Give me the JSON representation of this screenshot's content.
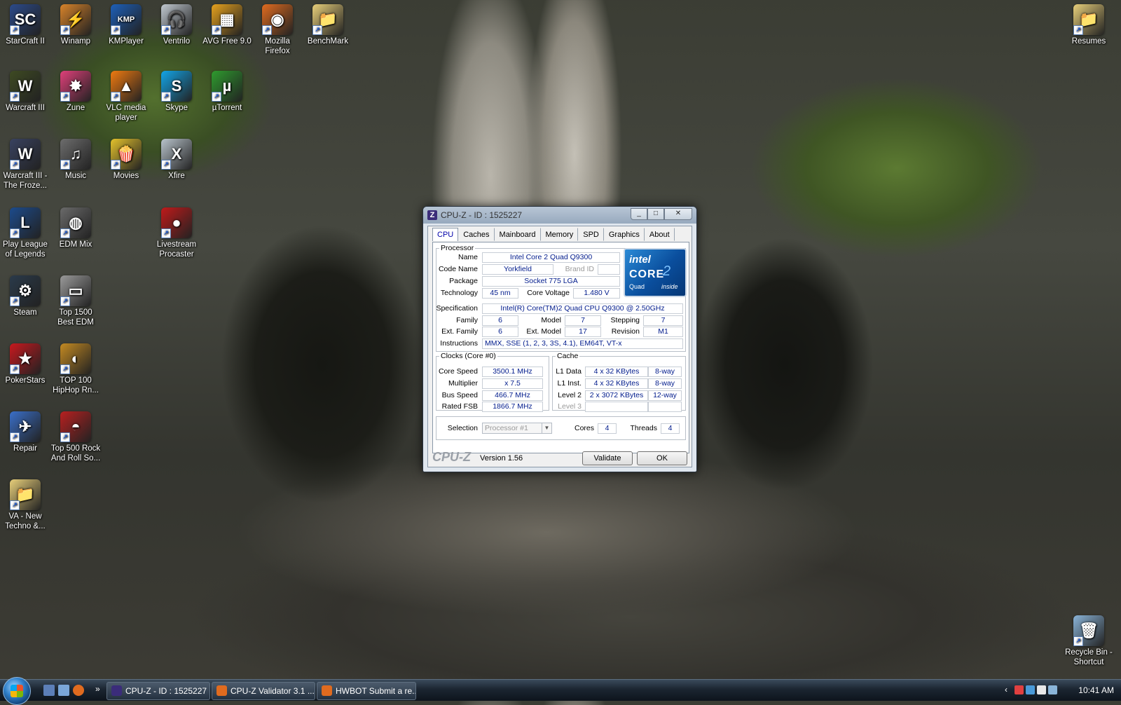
{
  "desktop": {
    "icons": [
      {
        "label": "StarCraft II",
        "symbol": "SC",
        "color": "#2b4a8a"
      },
      {
        "label": "Winamp",
        "symbol": "⚡",
        "color": "#d8832a"
      },
      {
        "label": "KMPlayer",
        "symbol": "KMP",
        "color": "#1d5fb8"
      },
      {
        "label": "Ventrilo",
        "symbol": "🎧",
        "color": "#c0c8d0"
      },
      {
        "label": "AVG Free 9.0",
        "symbol": "▦",
        "color": "#e6a11d"
      },
      {
        "label": "Mozilla Firefox",
        "symbol": "◉",
        "color": "#e06b1f"
      },
      {
        "label": "BenchMark",
        "symbol": "📁",
        "color": "#e8cf7a"
      },
      {
        "label": "Warcraft III",
        "symbol": "W",
        "color": "#3e4a22"
      },
      {
        "label": "Zune",
        "symbol": "✸",
        "color": "#e0407a"
      },
      {
        "label": "VLC media player",
        "symbol": "▲",
        "color": "#f07a10"
      },
      {
        "label": "Skype",
        "symbol": "S",
        "color": "#12a5e8"
      },
      {
        "label": "µTorrent",
        "symbol": "µ",
        "color": "#2e9b2e"
      },
      {
        "label": "Warcraft III - The Froze...",
        "symbol": "W",
        "color": "#394260"
      },
      {
        "label": "Music",
        "symbol": "♫",
        "color": "#6d6d6d"
      },
      {
        "label": "Movies",
        "symbol": "🍿",
        "color": "#e4c22c"
      },
      {
        "label": "Xfire",
        "symbol": "X",
        "color": "#b9c4cc"
      },
      {
        "label": "Play League of Legends",
        "symbol": "L",
        "color": "#1c4b8c"
      },
      {
        "label": "EDM Mix",
        "symbol": "◍",
        "color": "#6a6a6a"
      },
      {
        "label": "Livestream Procaster",
        "symbol": "●",
        "color": "#c01a1a"
      },
      {
        "label": "Steam",
        "symbol": "⚙",
        "color": "#2a3a4a"
      },
      {
        "label": "Top 1500 Best EDM",
        "symbol": "▭",
        "color": "#9a9a9a"
      },
      {
        "label": "PokerStars",
        "symbol": "★",
        "color": "#c8181e"
      },
      {
        "label": "TOP 100 HipHop Rn...",
        "symbol": "◐",
        "color": "#c48a22"
      },
      {
        "label": "Repair",
        "symbol": "✈",
        "color": "#3a6fc9"
      },
      {
        "label": "Top 500 Rock And Roll So...",
        "symbol": "◓",
        "color": "#b82020"
      },
      {
        "label": "VA - New Techno &...",
        "symbol": "📁",
        "color": "#e8cf7a"
      },
      {
        "label": "Resumes",
        "symbol": "📁",
        "color": "#e8cf7a"
      },
      {
        "label": "Recycle Bin - Shortcut",
        "symbol": "🗑",
        "color": "#8ab4d8"
      }
    ]
  },
  "cpuz": {
    "title": "CPU-Z - ID : 1525227",
    "icon_letter": "Z",
    "window_buttons": {
      "minimize": "_",
      "maximize": "□",
      "close": "✕"
    },
    "tabs": [
      "CPU",
      "Caches",
      "Mainboard",
      "Memory",
      "SPD",
      "Graphics",
      "About"
    ],
    "processor": {
      "legend": "Processor",
      "name_label": "Name",
      "name": "Intel Core 2 Quad Q9300",
      "code_name_label": "Code Name",
      "code_name": "Yorkfield",
      "brand_id_label": "Brand ID",
      "brand_id": "",
      "package_label": "Package",
      "package": "Socket 775 LGA",
      "technology_label": "Technology",
      "technology": "45 nm",
      "core_voltage_label": "Core Voltage",
      "core_voltage": "1.480 V",
      "specification_label": "Specification",
      "specification": "Intel(R) Core(TM)2 Quad  CPU   Q9300  @ 2.50GHz",
      "family_label": "Family",
      "family": "6",
      "model_label": "Model",
      "model": "7",
      "stepping_label": "Stepping",
      "stepping": "7",
      "ext_family_label": "Ext. Family",
      "ext_family": "6",
      "ext_model_label": "Ext. Model",
      "ext_model": "17",
      "revision_label": "Revision",
      "revision": "M1",
      "instructions_label": "Instructions",
      "instructions": "MMX, SSE (1, 2, 3, 3S, 4.1), EM64T, VT-x"
    },
    "logo": {
      "brand": "intel",
      "core": "CORE",
      "two": "2",
      "quad": "Quad",
      "inside": "inside"
    },
    "clocks": {
      "legend": "Clocks (Core #0)",
      "core_speed_label": "Core Speed",
      "core_speed": "3500.1 MHz",
      "multiplier_label": "Multiplier",
      "multiplier": "x 7.5",
      "bus_speed_label": "Bus Speed",
      "bus_speed": "466.7 MHz",
      "rated_fsb_label": "Rated FSB",
      "rated_fsb": "1866.7 MHz"
    },
    "cache": {
      "legend": "Cache",
      "l1_data_label": "L1 Data",
      "l1_data": "4 x 32 KBytes",
      "l1_data_way": "8-way",
      "l1_inst_label": "L1 Inst.",
      "l1_inst": "4 x 32 KBytes",
      "l1_inst_way": "8-way",
      "level2_label": "Level 2",
      "level2": "2 x 3072 KBytes",
      "level2_way": "12-way",
      "level3_label": "Level 3",
      "level3": "",
      "level3_way": ""
    },
    "selection": {
      "label": "Selection",
      "value": "Processor #1",
      "cores_label": "Cores",
      "cores": "4",
      "threads_label": "Threads",
      "threads": "4"
    },
    "footer": {
      "brand": "CPU-Z",
      "version": "Version 1.56",
      "validate": "Validate",
      "ok": "OK"
    }
  },
  "taskbar": {
    "overflow": "»",
    "buttons": [
      {
        "label": "CPU-Z - ID : 1525227",
        "color": "#3b2c7a"
      },
      {
        "label": "CPU-Z Validator 3.1 ...",
        "color": "#e06b1f"
      },
      {
        "label": "HWBOT Submit a re...",
        "color": "#e06b1f"
      }
    ],
    "clock": "10:41 AM",
    "tray_overflow": "‹"
  }
}
